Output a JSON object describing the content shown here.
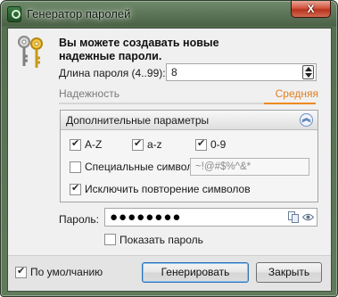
{
  "window": {
    "title": "Генератор паролей",
    "close_glyph": "X"
  },
  "header": {
    "heading": "Вы можете создавать новые надежные пароли."
  },
  "length": {
    "label": "Длина пароля (4..99):",
    "value": "8"
  },
  "reliability": {
    "label": "Надежность",
    "value": "Средняя",
    "fill": 0.2,
    "color": "#ee8a1e"
  },
  "advanced": {
    "title": "Дополнительные параметры",
    "collapse_icon": "double-chevron-up-icon",
    "options": [
      {
        "label": "A-Z",
        "checked": true
      },
      {
        "label": "a-z",
        "checked": true
      },
      {
        "label": "0-9",
        "checked": true
      },
      {
        "label": "Специальные символы:",
        "checked": false
      },
      {
        "label": "Исключить повторение символов",
        "checked": true
      }
    ],
    "special_chars": "~!@#$%^&*"
  },
  "password": {
    "label": "Пароль:",
    "masked": "●●●●●●●●",
    "copy_icon": "copy-icon",
    "show_icon": "eye-icon"
  },
  "show_password": {
    "label": "Показать пароль",
    "checked": false
  },
  "footer": {
    "default": {
      "label": "По умолчанию",
      "checked": true
    },
    "generate_label": "Генерировать",
    "close_label": "Закрыть"
  },
  "colors": {
    "accent": "#ee8a1e",
    "frame": "#4b6146"
  }
}
